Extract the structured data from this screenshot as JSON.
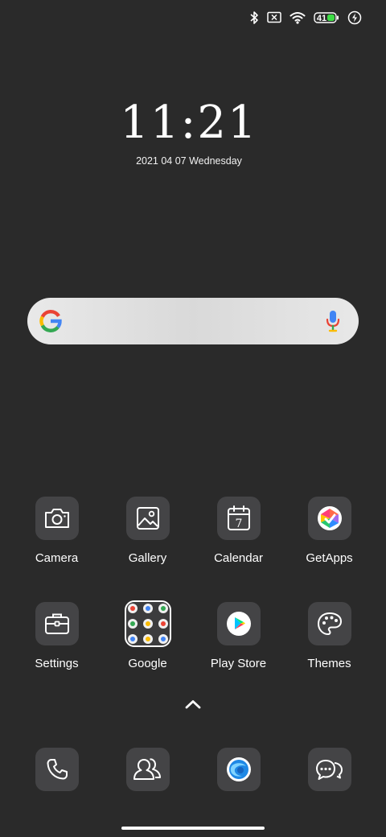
{
  "status_bar": {
    "icons": [
      "bluetooth-icon",
      "no-sim-icon",
      "wifi-icon",
      "battery-icon",
      "charging-icon"
    ],
    "battery_level": "41"
  },
  "clock": {
    "time": "11:21",
    "date": "2021 04 07 Wednesday"
  },
  "search": {
    "logo": "google-g-icon",
    "mic": "microphone-icon"
  },
  "apps_row1": [
    {
      "label": "Camera",
      "icon": "camera-icon"
    },
    {
      "label": "Gallery",
      "icon": "gallery-icon"
    },
    {
      "label": "Calendar",
      "icon": "calendar-icon",
      "day": "7"
    },
    {
      "label": "GetApps",
      "icon": "getapps-icon"
    }
  ],
  "apps_row2": [
    {
      "label": "Settings",
      "icon": "settings-briefcase-icon"
    },
    {
      "label": "Google",
      "icon": "folder-icon"
    },
    {
      "label": "Play Store",
      "icon": "play-store-icon"
    },
    {
      "label": "Themes",
      "icon": "palette-icon"
    }
  ],
  "dock": [
    {
      "icon": "phone-icon"
    },
    {
      "icon": "contacts-icon"
    },
    {
      "icon": "browser-icon"
    },
    {
      "icon": "messages-icon"
    }
  ],
  "colors": {
    "background": "#2a2a2a",
    "icon_tile": "#444446",
    "battery_green": "#3ddc45",
    "google_blue": "#4285F4",
    "google_red": "#EA4335",
    "google_yellow": "#FBBC05",
    "google_green": "#34A853"
  }
}
